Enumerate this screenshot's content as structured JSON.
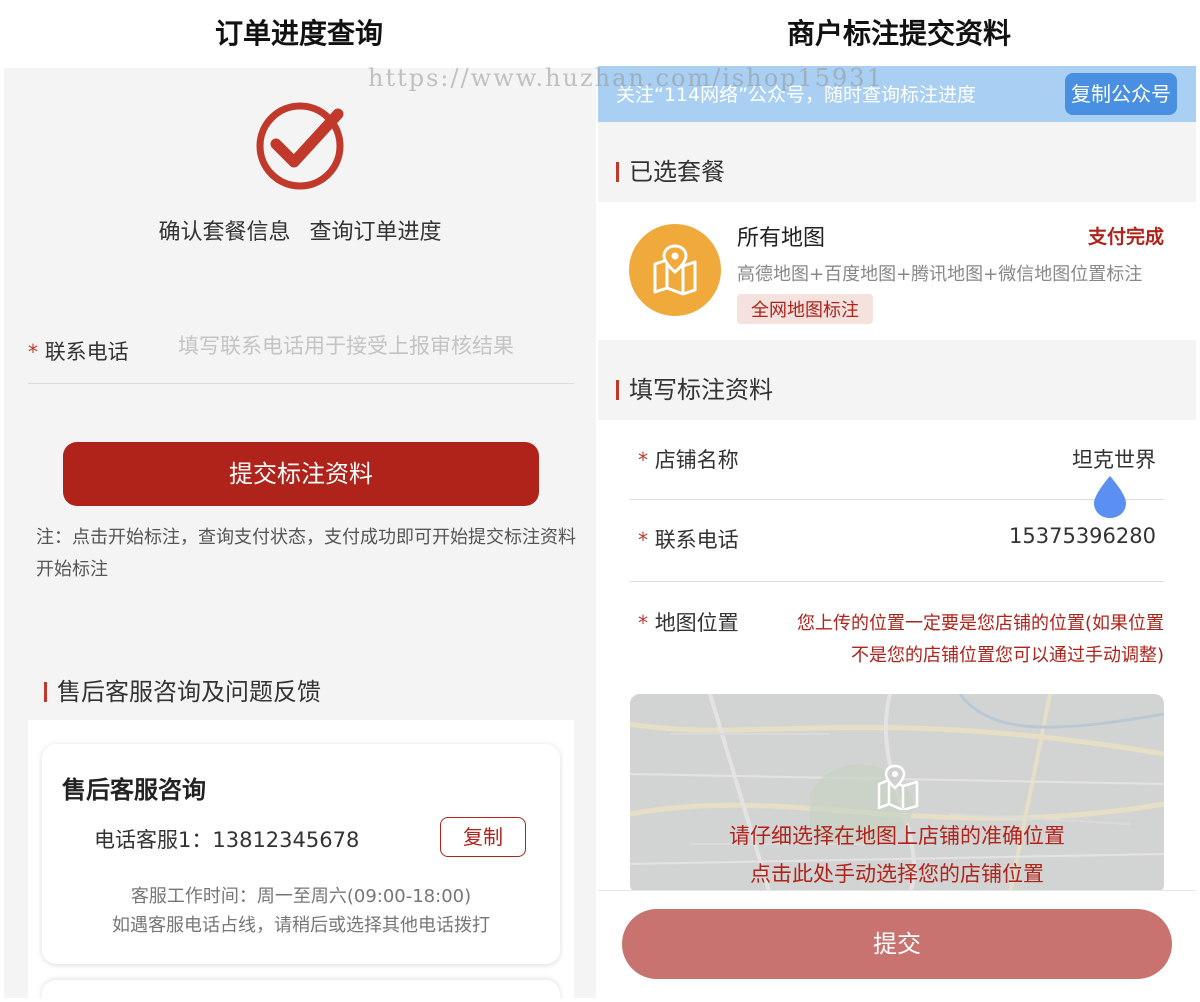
{
  "headings": {
    "left": "订单进度查询",
    "right": "商户标注提交资料"
  },
  "watermark": "https://www.huzhan.com/ishop15931",
  "left": {
    "confirm_a": "确认套餐信息",
    "confirm_b": "查询订单进度",
    "phone": {
      "required_mark": "*",
      "label": "联系电话",
      "placeholder": "填写联系电话用于接受上报审核结果"
    },
    "submit_label": "提交标注资料",
    "note": "注：点击开始标注，查询支付状态，支付成功即可开始提交标注资料开始标注",
    "after_sales_title": "售后客服咨询及问题反馈",
    "service": {
      "title": "售后客服咨询",
      "phone_text": "电话客服1：13812345678",
      "copy_label": "复制",
      "hours": "客服工作时间：周一至周六(09:00-18:00)",
      "tip": "如遇客服电话占线，请稍后或选择其他电话拨打"
    }
  },
  "right": {
    "banner": {
      "text": "关注“114网络”公众号，随时查询标注进度",
      "button": "复制公众号"
    },
    "selected_title": "已选套餐",
    "package": {
      "name": "所有地图",
      "status": "支付完成",
      "desc": "高德地图+百度地图+腾讯地图+微信地图位置标注",
      "tag": "全网地图标注"
    },
    "fill_title": "填写标注资料",
    "form": {
      "required_mark": "*",
      "store_label": "店铺名称",
      "store_value": "坦克世界",
      "phone_label": "联系电话",
      "phone_value": "15375396280",
      "map_label": "地图位置",
      "map_hint_1": "您上传的位置一定要是您店铺的位置(如果位置",
      "map_hint_2": "不是您的店铺位置您可以通过手动调整)"
    },
    "map": {
      "line1": "请仔细选择在地图上店铺的准确位置",
      "line2": "点击此处手动选择您的店铺位置"
    },
    "submit_label": "提交"
  },
  "colors": {
    "brand_red": "#b0231b",
    "banner_blue": "#a9cff3",
    "button_blue": "#4a90e2",
    "package_orange": "#f0a93b",
    "disabled_submit": "#c97370"
  }
}
